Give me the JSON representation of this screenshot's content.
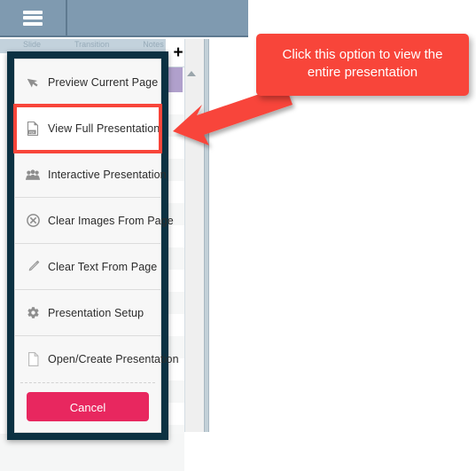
{
  "app": {
    "toolbar": {
      "menu_icon": "hamburger-icon"
    },
    "sub_bar": {
      "labels": [
        "Slide",
        "Transition",
        "Notes"
      ]
    },
    "panel": {
      "add_button_label": "+",
      "add_button_icon": "plus-icon",
      "settings_icon": "gear-icon",
      "scroll_up_icon": "triangle-up-icon",
      "swatch_color": "#b0a0cc"
    }
  },
  "modal": {
    "name": "presentation-action-sheet",
    "frame_color": "#0c3142",
    "items": [
      {
        "id": "preview-current-page",
        "label": "Preview Current Page",
        "icon": "cursor-arrow-icon",
        "highlighted": false
      },
      {
        "id": "view-full-presentation",
        "label": "View Full Presentation",
        "icon": "pdf-file-icon",
        "highlighted": true
      },
      {
        "id": "interactive-presentation",
        "label": "Interactive Presentation",
        "icon": "people-group-icon",
        "highlighted": false
      },
      {
        "id": "clear-images-from-page",
        "label": "Clear Images From Page",
        "icon": "close-circle-icon",
        "highlighted": false
      },
      {
        "id": "clear-text-from-page",
        "label": "Clear Text From Page",
        "icon": "pencil-icon",
        "highlighted": false
      },
      {
        "id": "presentation-setup",
        "label": "Presentation Setup",
        "icon": "gear-icon",
        "highlighted": false
      },
      {
        "id": "open-create-presentation",
        "label": "Open/Create Presentation",
        "icon": "document-icon",
        "highlighted": false
      }
    ],
    "cancel": {
      "label": "Cancel",
      "color": "#e8275f"
    }
  },
  "annotation": {
    "callout_text": "Click this option to view the entire presentation",
    "color": "#f8453a",
    "arrow_icon": "arrow-pointing-left-icon",
    "points_to": "view-full-presentation"
  }
}
